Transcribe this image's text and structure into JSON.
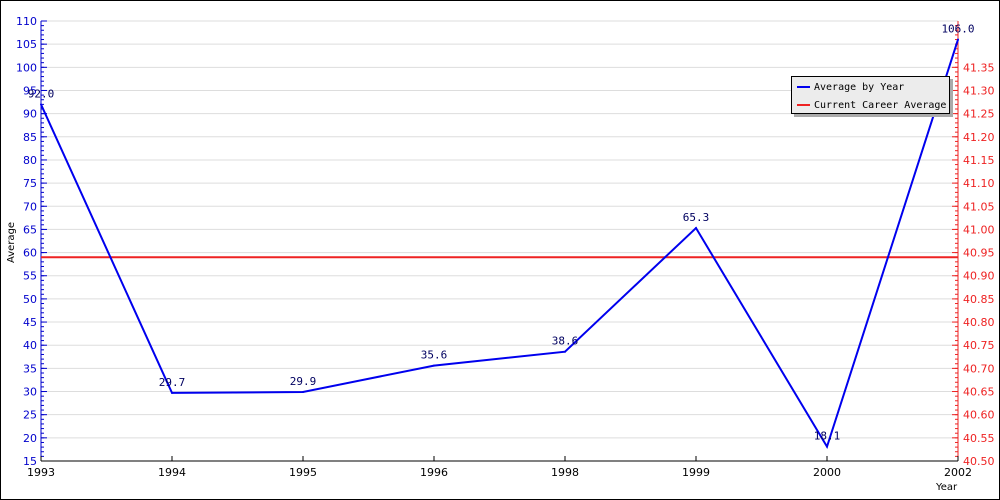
{
  "chart_data": {
    "type": "line",
    "title": "",
    "xlabel": "Year",
    "ylabel": "Average",
    "categories": [
      "1993",
      "1994",
      "1995",
      "1996",
      "1998",
      "1999",
      "2000",
      "2002"
    ],
    "series": [
      {
        "name": "Average by Year",
        "color": "#0000ee",
        "axis": "left",
        "values": [
          92.0,
          29.7,
          29.9,
          35.6,
          38.6,
          65.3,
          18.1,
          106.0
        ],
        "labels": [
          "92.0",
          "29.7",
          "29.9",
          "35.6",
          "38.6",
          "65.3",
          "18.1",
          "106.0"
        ]
      },
      {
        "name": "Current Career Average",
        "color": "#ee2222",
        "axis": "right",
        "constant": 40.94
      }
    ],
    "y_left": {
      "ylim": [
        15,
        110
      ],
      "step": 5,
      "ticks": [
        "15",
        "20",
        "25",
        "30",
        "35",
        "40",
        "45",
        "50",
        "55",
        "60",
        "65",
        "70",
        "75",
        "80",
        "85",
        "90",
        "95",
        "100",
        "105",
        "110"
      ]
    },
    "y_right": {
      "ylim": [
        40.5,
        41.4
      ],
      "step": 0.05,
      "ticks": [
        "40.50",
        "40.55",
        "40.60",
        "40.65",
        "40.70",
        "40.75",
        "40.80",
        "40.85",
        "40.90",
        "40.95",
        "41.00",
        "41.05",
        "41.10",
        "41.15",
        "41.20",
        "41.25",
        "41.30",
        "41.35"
      ]
    },
    "grid": true,
    "legend_position": "top-right"
  },
  "legend": {
    "items": [
      {
        "label": "Average by Year",
        "color": "#0000ee"
      },
      {
        "label": "Current Career Average",
        "color": "#ee2222"
      }
    ]
  }
}
